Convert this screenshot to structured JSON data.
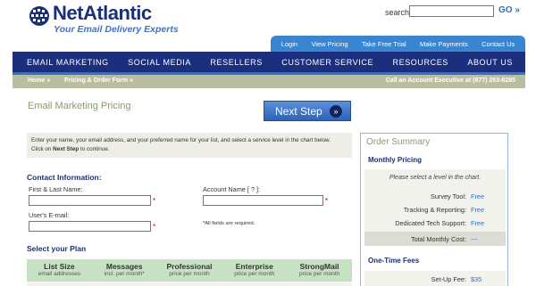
{
  "brand": {
    "logo_text": "NetAtlantic",
    "tagline": "Your Email Delivery Experts"
  },
  "search": {
    "label": "search:",
    "value": "",
    "go_label": "GO »"
  },
  "utility_nav": [
    "Login",
    "View Pricing",
    "Take Free Trial",
    "Make Payments",
    "Contact Us"
  ],
  "main_nav": [
    "EMAIL MARKETING",
    "SOCIAL MEDIA",
    "RESELLERS",
    "CUSTOMER SERVICE",
    "RESOURCES",
    "ABOUT US"
  ],
  "breadcrumb": {
    "home": "Home »",
    "current": "Pricing & Order Form »",
    "phone": "Call an Account Executive at (877) 263-8285"
  },
  "page": {
    "title": "Email Marketing Pricing",
    "next_step_label": "Next Step",
    "next_step_arrow": "»"
  },
  "instructions": {
    "line1": "Enter your name, your email address, and your preferred name for your list, and select a service level in the chart below.",
    "line2_prefix": "Click on ",
    "line2_bold": "Next Step",
    "line2_suffix": " to continue."
  },
  "contact": {
    "heading": "Contact Information:",
    "first_last_label": "First & Last Name:",
    "first_last_value": "",
    "account_name_label": "Account Name [ ? ]:",
    "account_name_value": "",
    "email_label": "User's E-mail:",
    "email_value": "",
    "required_marker": "*",
    "required_note": "*All fields are required."
  },
  "plan": {
    "heading": "Select your Plan",
    "columns": [
      {
        "title": "List Size",
        "subtitle": "email addresses"
      },
      {
        "title": "Messages",
        "subtitle": "incl. per month*"
      },
      {
        "title": "Professional",
        "subtitle": "price per month"
      },
      {
        "title": "Enterprise",
        "subtitle": "price per month"
      },
      {
        "title": "StrongMail",
        "subtitle": "price per month"
      }
    ]
  },
  "summary": {
    "title": "Order Summary",
    "monthly_heading": "Monthly Pricing",
    "hint": "Please select a level in the chart.",
    "rows": [
      {
        "label": "Survey Tool:",
        "value": "Free"
      },
      {
        "label": "Tracking & Reporting:",
        "value": "Free"
      },
      {
        "label": "Dedicated Tech Support:",
        "value": "Free"
      }
    ],
    "total_label": "Total Monthly Cost:",
    "total_value": "---",
    "onetime_heading": "One-Time Fees",
    "setup_label": "Set-Up Fee:",
    "setup_value": "$35"
  },
  "colors": {
    "brand_navy": "#1b2f7e",
    "brand_blue": "#3a85cf",
    "link_blue": "#2f6fc2",
    "crumb_bar": "#b7bfa0",
    "table_header": "#c6e2c2"
  }
}
